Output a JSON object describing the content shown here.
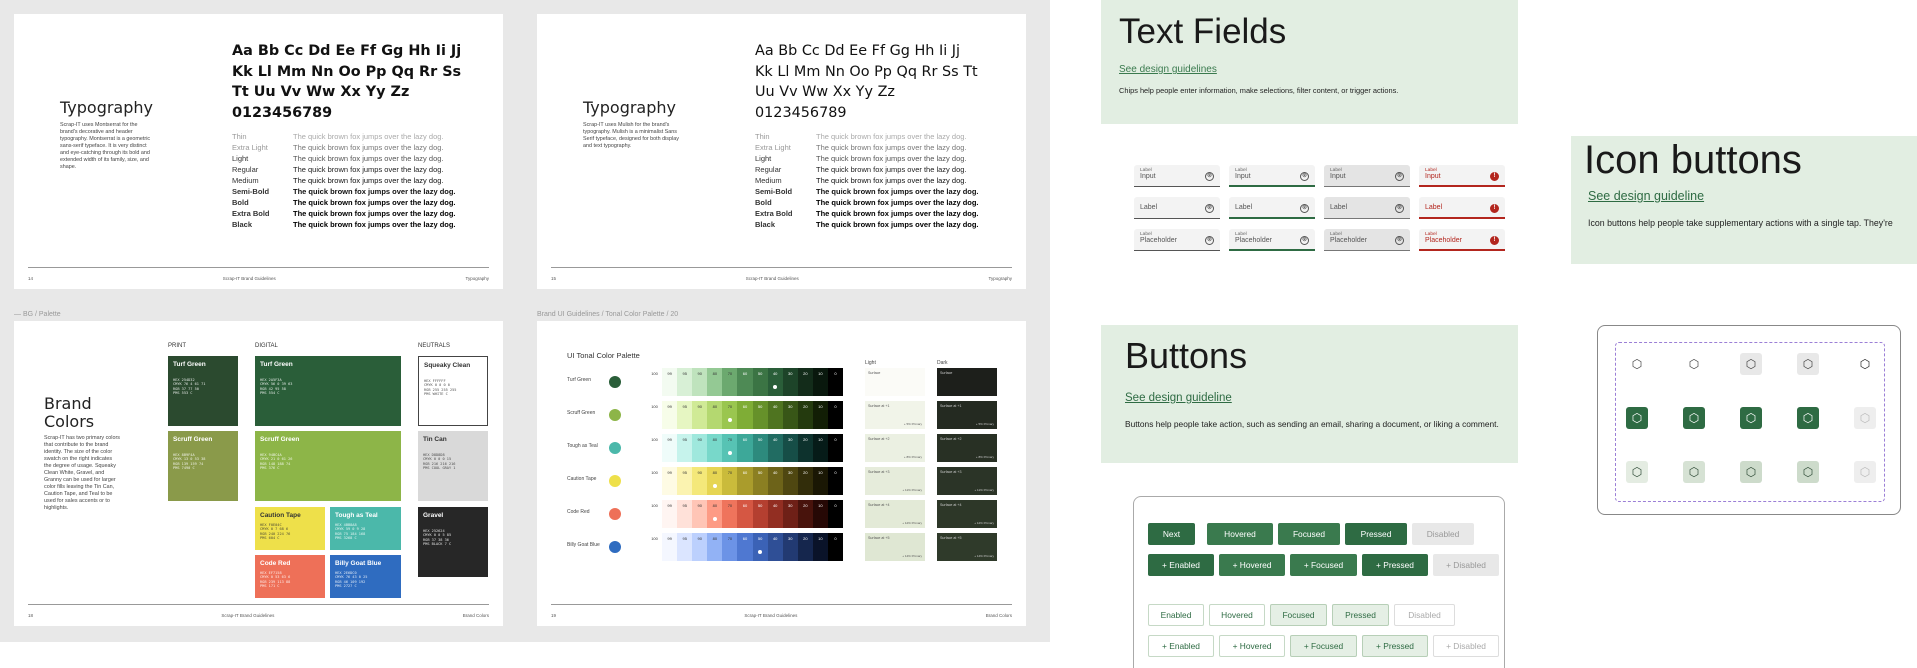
{
  "typography_page_a": {
    "title": "Typography",
    "intro": "Scrap-IT uses Montserrat for the brand's decorative and header typography. Montserrat is a geometric sans-serif typeface. It is very distinct and eye-catching through its bold and extended width of its family, size, and shape.",
    "glyph_lines": [
      "Aa Bb Cc Dd Ee Ff Gg Hh Ii Jj",
      "Kk Ll Mm Nn Oo Pp Qq Rr Ss",
      "Tt Uu Vv Ww Xx Yy Zz",
      "0123456789"
    ],
    "footer_left": "14",
    "footer_center": "Scrap-IT Brand Guidelines",
    "footer_right": "Typography"
  },
  "typography_page_b": {
    "title": "Typography",
    "intro": "Scrap-IT uses Mulish for the brand's typography. Mulish is a minimalist Sans Serif typeface, designed for both display and text typography.",
    "glyph_lines": [
      "Aa Bb Cc Dd Ee Ff Gg Hh Ii Jj",
      "Kk Ll Mm Nn Oo Pp Qq Rr Ss Tt",
      "Uu Vv Ww Xx Yy Zz",
      "0123456789"
    ],
    "footer_left": "15",
    "footer_center": "Scrap-IT Brand Guidelines",
    "footer_right": "Typography"
  },
  "weights_a": [
    {
      "name": "Thin",
      "sample": "The quick brown fox jumps over the lazy dog."
    },
    {
      "name": "Extra Light",
      "sample": "The quick brown fox jumps over the lazy dog."
    },
    {
      "name": "Light",
      "sample": "The quick brown fox jumps over the lazy dog."
    },
    {
      "name": "Regular",
      "sample": "The quick brown fox jumps over the lazy dog."
    },
    {
      "name": "Medium",
      "sample": "The quick brown fox jumps over the lazy dog."
    },
    {
      "name": "Semi-Bold",
      "sample": "The quick brown fox jumps over the lazy dog."
    },
    {
      "name": "Bold",
      "sample": "The quick brown fox jumps over the lazy dog."
    },
    {
      "name": "Extra Bold",
      "sample": "The quick brown fox jumps over the lazy dog."
    },
    {
      "name": "Black",
      "sample": "The quick brown fox jumps over the lazy dog."
    }
  ],
  "weights_b": [
    {
      "name": "Thin",
      "sample": "The quick brown fox jumps over the lazy dog."
    },
    {
      "name": "Extra Light",
      "sample": "The quick brown fox jumps over the lazy dog."
    },
    {
      "name": "Light",
      "sample": "The quick brown fox jumps over the lazy dog."
    },
    {
      "name": "Regular",
      "sample": "The quick brown fox jumps over the lazy dog."
    },
    {
      "name": "Medium",
      "sample": "The quick brown fox jumps over the lazy dog."
    },
    {
      "name": "Semi-Bold",
      "sample": "The quick brown fox jumps over the lazy dog."
    },
    {
      "name": "Bold",
      "sample": "The quick brown fox jumps over the lazy dog."
    },
    {
      "name": "Extra Bold",
      "sample": "The quick brown fox jumps over the lazy dog."
    },
    {
      "name": "Black",
      "sample": "The quick brown fox jumps over the lazy dog."
    }
  ],
  "palette_page": {
    "breadcrumb": "— BG / Palette",
    "title": "Brand Colors",
    "intro": "Scrap-IT has two primary colors that contribute to the brand identity. The size of the color swatch on the right indicates the degree of usage. Squeaky Clean White, Gravel, and Granny can be used for larger color fills leaving the Tin Can, Caution Tape, and Teal to be used for sales accents or to highlights.",
    "sections": {
      "print": "PRINT",
      "digital": "DIGITAL",
      "neutrals": "NEUTRALS"
    },
    "swatches": {
      "turf_print": {
        "name": "Turf Green",
        "codes": "HEX 254D32\nCMYK 76 4 61 71\nRGB 37 77 50\nPMS 553 C",
        "color": "#2b4a2f"
      },
      "scruff_print": {
        "name": "Scruff Green",
        "codes": "HEX 8B9F4A\nCMYK 13 0 53 38\nRGB 139 159 74\nPMS 7490 C",
        "color": "#8a9a4a"
      },
      "turf_digital": {
        "name": "Turf Green",
        "codes": "HEX 2A5F3A\nCMYK 56 0 39 63\nRGB 42 95 58\nPMS 554 C",
        "color": "#2a5e39"
      },
      "scruff_digital": {
        "name": "Scruff Green",
        "codes": "HEX 94BC4A\nCMYK 21 0 61 26\nRGB 148 188 74\nPMS 376 C",
        "color": "#8db548"
      },
      "caution": {
        "name": "Caution Tape",
        "codes": "HEX F0E04C\nCMYK 0 7 68 6\nRGB 240 224 76\nPMS 604 C",
        "color": "#eee04a"
      },
      "tough": {
        "name": "Tough as Teal",
        "codes": "HEX 4BB8A8\nCMYK 59 0 9 28\nRGB 75 184 168\nPMS 3268 C",
        "color": "#4bb8aa"
      },
      "code_red": {
        "name": "Code Red",
        "codes": "HEX EF7158\nCMYK 0 53 63 6\nRGB 239 113 88\nPMS 171 C",
        "color": "#ee7058"
      },
      "billy": {
        "name": "Billy Goat Blue",
        "codes": "HEX 2E6DC0\nCMYK 76 43 0 25\nRGB 46 109 192\nPMS 2727 C",
        "color": "#2f6cc0"
      },
      "squeaky": {
        "name": "Squeaky Clean",
        "codes": "HEX FFFFFF\nCMYK 0 0 0 0\nRGB 255 255 255\nPMS WHITE C",
        "color": "#ffffff"
      },
      "tin": {
        "name": "Tin Can",
        "codes": "HEX D8D8D8\nCMYK 0 0 0 15\nRGB 216 216 216\nPMS COOL GRAY 1",
        "color": "#d9d9d9"
      },
      "gravel": {
        "name": "Gravel",
        "codes": "HEX 252624\nCMYK 0 0 5 85\nRGB 37 38 36\nPMS BLACK 7 C",
        "color": "#272727"
      }
    },
    "footer_left": "18",
    "footer_center": "Scrap-IT Brand Guidelines",
    "footer_right": "Brand Colors"
  },
  "tonal_page": {
    "breadcrumb": "Brand UI Guidelines / Tonal Color Palette / 20",
    "title": "UI Tonal Color Palette",
    "light_label": "Light",
    "dark_label": "Dark",
    "tone_steps": [
      "100",
      "99",
      "95",
      "90",
      "80",
      "70",
      "60",
      "50",
      "40",
      "30",
      "20",
      "10",
      "0"
    ],
    "rows": [
      {
        "name": "Turf Green",
        "accent": "#2a5e39",
        "tones": [
          "#ffffff",
          "#f3fbf1",
          "#d8f0d6",
          "#bfe3bd",
          "#94c994",
          "#6ca96f",
          "#4e8a55",
          "#3b7444",
          "#2a5e39",
          "#1d4429",
          "#132c1a",
          "#09180d",
          "#000000"
        ]
      },
      {
        "name": "Scruff Green",
        "accent": "#8db548",
        "tones": [
          "#ffffff",
          "#f7fde9",
          "#e6f6c2",
          "#d0ea96",
          "#b4d870",
          "#9ac64f",
          "#7fad36",
          "#66912a",
          "#4f7420",
          "#385617",
          "#243a0e",
          "#121e05",
          "#000000"
        ]
      },
      {
        "name": "Tough as Teal",
        "accent": "#4bb8aa",
        "tones": [
          "#ffffff",
          "#effcfa",
          "#c6f3ec",
          "#9fe8dd",
          "#78d8ca",
          "#57c3b4",
          "#3da899",
          "#2d8a7d",
          "#216c62",
          "#164e47",
          "#0d322d",
          "#061b18",
          "#000000"
        ]
      },
      {
        "name": "Caution Tape",
        "accent": "#eee04a",
        "tones": [
          "#ffffff",
          "#fefbe4",
          "#fbf3b0",
          "#f4e87a",
          "#e6d553",
          "#cabb3b",
          "#aa9c2c",
          "#8b7f22",
          "#6d6319",
          "#4f4711",
          "#322d0a",
          "#1a1704",
          "#000000"
        ]
      },
      {
        "name": "Code Red",
        "accent": "#ee7058",
        "tones": [
          "#ffffff",
          "#fff5f2",
          "#ffe1d9",
          "#ffc5b6",
          "#fd9b85",
          "#ef745c",
          "#d55743",
          "#b43f30",
          "#922e22",
          "#6e2017",
          "#48130c",
          "#260805",
          "#000000"
        ]
      },
      {
        "name": "Billy Goat Blue",
        "accent": "#2f6cc0",
        "tones": [
          "#ffffff",
          "#f4f7ff",
          "#dbe5ff",
          "#bcd0fd",
          "#92b2f5",
          "#6c93e6",
          "#4f78d1",
          "#3b62b6",
          "#2f4f96",
          "#223a72",
          "#15264d",
          "#0a1329",
          "#000000"
        ]
      }
    ],
    "light_surfaces": [
      {
        "name": "Surface",
        "foot": ""
      },
      {
        "name": "Surface at +1",
        "foot": "+ 5% Primary"
      },
      {
        "name": "Surface at +2",
        "foot": "+ 8% Primary"
      },
      {
        "name": "Surface at +3",
        "foot": "+ 11% Primary"
      },
      {
        "name": "Surface at +4",
        "foot": "+ 12% Primary"
      },
      {
        "name": "Surface at +5",
        "foot": "+ 14% Primary"
      }
    ],
    "dark_surfaces": [
      {
        "name": "Surface",
        "foot": ""
      },
      {
        "name": "Surface at +1",
        "foot": "+ 5% Primary"
      },
      {
        "name": "Surface at +2",
        "foot": "+ 8% Primary"
      },
      {
        "name": "Surface at +3",
        "foot": "+ 11% Primary"
      },
      {
        "name": "Surface at +4",
        "foot": "+ 12% Primary"
      },
      {
        "name": "Surface at +5",
        "foot": "+ 14% Primary"
      }
    ],
    "footer_left": "19",
    "footer_center": "Scrap-IT Brand Guidelines",
    "footer_right": "Brand Colors"
  },
  "text_fields": {
    "title": "Text Fields",
    "link": "See design guidelines",
    "description": "Chips help people enter information, make selections, filter content, or trigger actions.",
    "label": "Label",
    "input": "Input",
    "placeholder": "Placeholder",
    "clear_glyph": "⊗",
    "error_glyph": "!"
  },
  "buttons": {
    "title": "Buttons",
    "link": "See design guideline",
    "description": "Buttons help people take action, such as sending an email, sharing a document, or liking a comment.",
    "filled_row": [
      "Next",
      "Hovered",
      "Focused",
      "Pressed",
      "Disabled"
    ],
    "filled_icon_row": [
      "+ Enabled",
      "+ Hovered",
      "+ Focused",
      "+ Pressed",
      "+ Disabled"
    ],
    "outline_row": [
      "Enabled",
      "Hovered",
      "Focused",
      "Pressed",
      "Disabled"
    ],
    "outline_icon_row": [
      "+ Enabled",
      "+ Hovered",
      "+ Focused",
      "+ Pressed",
      "+ Disabled"
    ]
  },
  "icon_buttons": {
    "title": "Icon buttons",
    "link": "See design guideline",
    "description": "Icon buttons help people take supplementary actions with a single tap. They're",
    "glyph": "⬡"
  }
}
